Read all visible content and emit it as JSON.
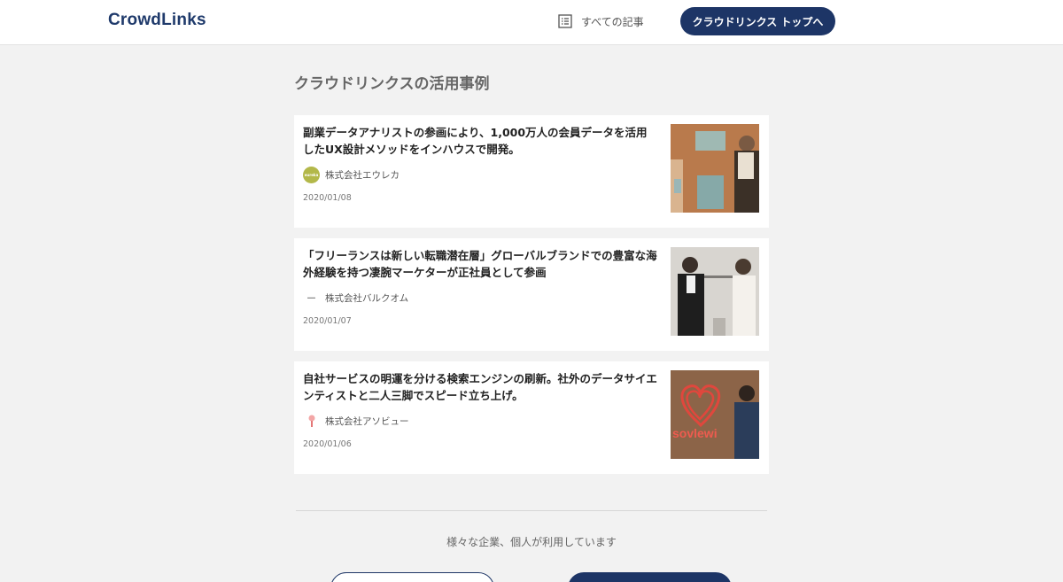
{
  "header": {
    "logo_text": "CrowdLinks",
    "nav_all_label": "すべての記事",
    "top_button_label": "クラウドリンクス トップへ"
  },
  "section": {
    "title": "クラウドリンクスの活用事例"
  },
  "articles": [
    {
      "title": "副業データアナリストの参画により、1,000万人の会員データを活用したUX設計メソッドをインハウスで開発。",
      "company": "株式会社エウレカ",
      "date": "2020/01/08"
    },
    {
      "title": "「フリーランスは新しい転職潜在層」グローバルブランドでの豊富な海外経験を持つ凄腕マーケターが正社員として参画",
      "company": "株式会社バルクオム",
      "date": "2020/01/07"
    },
    {
      "title": "自社サービスの明運を分ける検索エンジンの刷新。社外のデータサイエンティストと二人三脚でスピード立ち上げ。",
      "company": "株式会社アソビュー",
      "date": "2020/01/06"
    }
  ],
  "footer": {
    "used_by_text": "様々な企業、個人が利用しています"
  },
  "colors": {
    "brand_navy": "#1d3566",
    "background": "#f2f2f2"
  }
}
